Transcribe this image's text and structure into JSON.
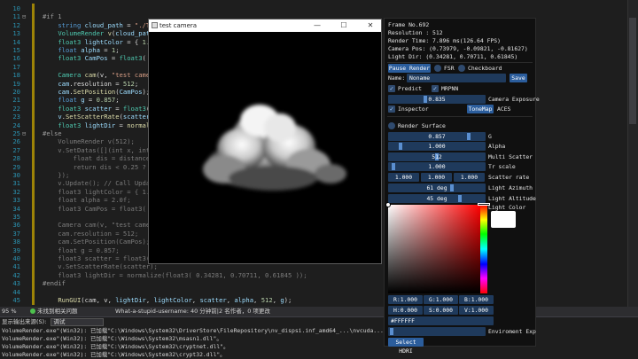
{
  "editor": {
    "lines": [
      {
        "n": "10",
        "fold": "",
        "html": ""
      },
      {
        "n": "11",
        "fold": "⊟",
        "html": "<span class='tok-pp'>#if 1</span>"
      },
      {
        "n": "12",
        "fold": "",
        "html": "    <span class='tok-kw'>string</span> <span class='tok-var'>cloud_path</span> = <span class='tok-str'>\"./Test</span><span class='tok-dim'>Scenes/CLOUDS/</span>"
      },
      {
        "n": "13",
        "fold": "",
        "html": "    <span class='tok-ty'>VolumeRender</span> <span class='tok-fn'>v</span>(<span class='tok-var'>cloud_path</span>)"
      },
      {
        "n": "14",
        "fold": "",
        "html": "    <span class='tok-ty'>float3</span> <span class='tok-var'>lightColor</span> = { <span class='tok-num'>1.0</span>,"
      },
      {
        "n": "15",
        "fold": "",
        "html": "    <span class='tok-kw'>float</span> <span class='tok-var'>alpha</span> = <span class='tok-num'>1</span>;"
      },
      {
        "n": "16",
        "fold": "",
        "html": "    <span class='tok-ty'>float3</span> <span class='tok-var'>CamPos</span> = <span class='tok-ty'>float3</span>( <span class='tok-num'>0.</span>"
      },
      {
        "n": "17",
        "fold": "",
        "html": ""
      },
      {
        "n": "18",
        "fold": "",
        "html": "    <span class='tok-ty'>Camera</span> <span class='tok-fn'>cam</span>(v, <span class='tok-str'>\"test camera</span>"
      },
      {
        "n": "19",
        "fold": "",
        "html": "    <span class='tok-var'>cam</span>.resolution = <span class='tok-num'>512</span>;"
      },
      {
        "n": "20",
        "fold": "",
        "html": "    <span class='tok-var'>cam</span>.<span class='tok-fn'>SetPosition</span>(<span class='tok-var'>CamPos</span>);"
      },
      {
        "n": "21",
        "fold": "",
        "html": "    <span class='tok-kw'>float</span> <span class='tok-var'>g</span> = <span class='tok-num'>0.857</span>;"
      },
      {
        "n": "22",
        "fold": "",
        "html": "    <span class='tok-ty'>float3</span> <span class='tok-var'>scatter</span> = <span class='tok-ty'>float3</span>( <span class='tok-num'>1.</span>"
      },
      {
        "n": "23",
        "fold": "",
        "html": "    <span class='tok-var'>v</span>.<span class='tok-fn'>SetScatterRate</span>(<span class='tok-var'>scatter</span>);"
      },
      {
        "n": "24",
        "fold": "",
        "html": "    <span class='tok-ty'>float3</span> <span class='tok-var'>lightDir</span> = <span class='tok-fn'>normalize</span>"
      },
      {
        "n": "25",
        "fold": "⊟",
        "html": "<span class='tok-pp'>#else</span>"
      },
      {
        "n": "26",
        "fold": "",
        "html": "<span class='tok-dim'>    VolumeRender v(512);</span>"
      },
      {
        "n": "27",
        "fold": "",
        "html": "<span class='tok-dim'>    v.SetDatas([](int x, int y,</span>"
      },
      {
        "n": "28",
        "fold": "",
        "html": "<span class='tok-dim'>        float dis = distance(m</span>"
      },
      {
        "n": "29",
        "fold": "",
        "html": "<span class='tok-dim'>        return dis &lt; 0.25 ? 1.0</span>"
      },
      {
        "n": "30",
        "fold": "",
        "html": "<span class='tok-dim'>    });</span>"
      },
      {
        "n": "31",
        "fold": "",
        "html": "<span class='tok-dim'>    v.Update(); // Call Update</span>"
      },
      {
        "n": "32",
        "fold": "",
        "html": "<span class='tok-dim'>    float3 lightColor = { 1.0,</span>"
      },
      {
        "n": "33",
        "fold": "",
        "html": "<span class='tok-dim'>    float alpha = 2.0f;</span>"
      },
      {
        "n": "34",
        "fold": "",
        "html": "<span class='tok-dim'>    float3 CamPos = float3( 0.</span>"
      },
      {
        "n": "35",
        "fold": "",
        "html": ""
      },
      {
        "n": "36",
        "fold": "",
        "html": "<span class='tok-dim'>    Camera cam(v, \"test camera</span>"
      },
      {
        "n": "37",
        "fold": "",
        "html": "<span class='tok-dim'>    cam.resolution = 512;</span>"
      },
      {
        "n": "38",
        "fold": "",
        "html": "<span class='tok-dim'>    cam.SetPosition(CamPos);</span>"
      },
      {
        "n": "39",
        "fold": "",
        "html": "<span class='tok-dim'>    float g = 0.857;</span>"
      },
      {
        "n": "40",
        "fold": "",
        "html": "<span class='tok-dim'>    float3 scatter = float3( 1.</span>"
      },
      {
        "n": "41",
        "fold": "",
        "html": "<span class='tok-dim'>    v.SetScatterRate(scatter);</span>"
      },
      {
        "n": "42",
        "fold": "",
        "html": "<span class='tok-dim'>    float3 lightDir = normalize(float3( 0.34281, 0.70711, 0.61845 ));</span>"
      },
      {
        "n": "43",
        "fold": "",
        "html": "<span class='tok-pp'>#endif</span>"
      },
      {
        "n": "44",
        "fold": "",
        "html": ""
      },
      {
        "n": "45",
        "fold": "",
        "html": "    <span class='tok-fn'>RunGUI</span>(cam, v, <span class='tok-var'>lightDir</span>, <span class='tok-var'>lightColor</span>, <span class='tok-var'>scatter</span>, <span class='tok-var'>alpha</span>, <span class='tok-num'>512</span>, <span class='tok-var'>g</span>);"
      }
    ]
  },
  "statusbar": {
    "zoom": "95 %",
    "issues": "未找到相关问题",
    "git_message": "What-a-stupid-username: 40 分钟前|2 名作者，0 项更改"
  },
  "output": {
    "header_label": "显示输出来源(S):",
    "source": "调试",
    "lines": [
      "VolumeRender.exe\"(Win32): 已加载\"C:\\Windows\\System32\\DriverStore\\FileRepository\\nv_dispsi.inf_amd64_...\\nvcuda...\"。",
      "VolumeRender.exe\"(Win32): 已加载\"C:\\Windows\\System32\\msasn1.dll\"。",
      "VolumeRender.exe\"(Win32): 已加载\"C:\\Windows\\System32\\cryptnet.dll\"。",
      "VolumeRender.exe\"(Win32): 已加载\"C:\\Windows\\System32\\crypt32.dll\"。"
    ]
  },
  "camera_window": {
    "title": "test camera",
    "minimize": "—",
    "maximize": "☐",
    "close": "✕"
  },
  "gui": {
    "stats": {
      "frame": "Frame No.692",
      "resolution": "Resolution : 512",
      "render_time": "Render Time: 7.896 ms(126.64 FPS)",
      "camera_pos": "Camera Pos: (0.73979, -0.09821, -0.81627)",
      "light_dir": "Light Dir: (0.34281, 0.70711, 0.61845)"
    },
    "pause_render": "Pause Render",
    "fsr": "FSR",
    "checkboard": "Checkboard",
    "name_label": "Name:",
    "name_value": "Noname",
    "save": "Save",
    "predict": "Predict",
    "mrpnn": "MRPNN",
    "camera_exposure_value": "0.835",
    "camera_exposure_label": "Camera Exposure",
    "inspector": "Inspector",
    "tonemap": "ToneMap",
    "aces": "ACES",
    "render_surface": "Render Surface",
    "sliders": [
      {
        "label": "G",
        "value": "0.857",
        "level": 0.857
      },
      {
        "label": "Alpha",
        "value": "1.000",
        "level": 0.1
      },
      {
        "label": "Multi Scatter",
        "value": "512",
        "level": 0.5
      },
      {
        "label": "Tr scale",
        "value": "1.000",
        "level": 0.02
      },
      {
        "label": "Light Azimuth",
        "value": "61 deg",
        "level": 0.67
      },
      {
        "label": "Light Altitude",
        "value": "45 deg",
        "level": 0.75
      }
    ],
    "scatter_rate": {
      "values": [
        "1.000",
        "1.000",
        "1.000"
      ],
      "label": "Scatter rate"
    },
    "light_color_label": "Light Color",
    "rgb_row": [
      "R:1.000",
      "G:1.000",
      "B:1.000"
    ],
    "hsv_row": [
      "H:0.000",
      "S:0.000",
      "V:1.000"
    ],
    "hex": "#FFFFFF",
    "environment_label": "Enviroment Exp",
    "select_hdri": "Select HDRI"
  },
  "colors": {
    "accent": "#2b5d9c",
    "frame_bg": "#1f3a5c",
    "editor_bg": "#1e1e1e"
  }
}
